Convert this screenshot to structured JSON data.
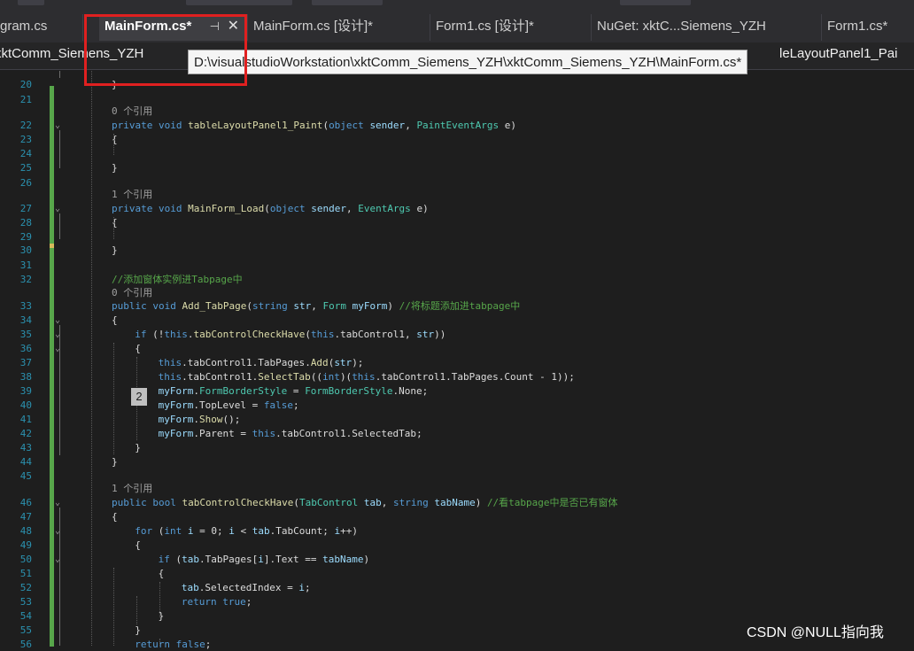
{
  "tabs": [
    {
      "label": "gram.cs"
    },
    {
      "label": "MainForm.cs*",
      "active": true,
      "pin_glyph": "⊣",
      "close_glyph": "✕"
    },
    {
      "label": "MainForm.cs [设计]*"
    },
    {
      "label": "Form1.cs [设计]*"
    },
    {
      "label": "NuGet: xktC...Siemens_YZH"
    },
    {
      "label": "Form1.cs*"
    }
  ],
  "navbar": {
    "project": "xktComm_Siemens_YZH",
    "member": "leLayoutPanel1_Pai"
  },
  "tooltip": "D:\\visualstudioWorkstation\\xktComm_Siemens_YZH\\xktComm_Siemens_YZH\\MainForm.cs*",
  "code_lines": [
    {
      "ln": "20",
      "text": "}"
    },
    {
      "ln": "21",
      "text": ""
    },
    {
      "ref": "0 个引用"
    },
    {
      "ln": "22",
      "text": "private void tableLayoutPanel1_Paint(object sender, PaintEventArgs e)"
    },
    {
      "ln": "23",
      "text": "{"
    },
    {
      "ln": "24",
      "text": ""
    },
    {
      "ln": "25",
      "text": "}"
    },
    {
      "ln": "26",
      "text": ""
    },
    {
      "ref": "1 个引用"
    },
    {
      "ln": "27",
      "text": "private void MainForm_Load(object sender, EventArgs e)"
    },
    {
      "ln": "28",
      "text": "{"
    },
    {
      "ln": "29",
      "text": ""
    },
    {
      "ln": "30",
      "text": "}"
    },
    {
      "ln": "31",
      "text": ""
    },
    {
      "ln": "32",
      "text": "//添加窗体实例进Tabpage中"
    },
    {
      "ref": "0 个引用"
    },
    {
      "ln": "33",
      "text": "public void Add_TabPage(string str, Form myForm) //将标题添加进tabpage中"
    },
    {
      "ln": "34",
      "text": "{"
    },
    {
      "ln": "35",
      "text": "if (!this.tabControlCheckHave(this.tabControl1, str))"
    },
    {
      "ln": "36",
      "text": "{"
    },
    {
      "ln": "37",
      "text": "this.tabControl1.TabPages.Add(str);"
    },
    {
      "ln": "38",
      "text": "this.tabControl1.SelectTab((int)(this.tabControl1.TabPages.Count - 1));"
    },
    {
      "ln": "39",
      "text": "myForm.FormBorderStyle = FormBorderStyle.None;"
    },
    {
      "ln": "40",
      "text": "myForm.TopLevel = false;"
    },
    {
      "ln": "41",
      "text": "myForm.Show();"
    },
    {
      "ln": "42",
      "text": "myForm.Parent = this.tabControl1.SelectedTab;"
    },
    {
      "ln": "43",
      "text": "}"
    },
    {
      "ln": "44",
      "text": "}"
    },
    {
      "ln": "45",
      "text": ""
    },
    {
      "ref": "1 个引用"
    },
    {
      "ln": "46",
      "text": "public bool tabControlCheckHave(TabControl tab, string tabName) //看tabpage中是否已有窗体"
    },
    {
      "ln": "47",
      "text": "{"
    },
    {
      "ln": "48",
      "text": "for (int i = 0; i < tab.TabCount; i++)"
    },
    {
      "ln": "49",
      "text": "{"
    },
    {
      "ln": "50",
      "text": "if (tab.TabPages[i].Text == tabName)"
    },
    {
      "ln": "51",
      "text": "{"
    },
    {
      "ln": "52",
      "text": "tab.SelectedIndex = i;"
    },
    {
      "ln": "53",
      "text": "return true;"
    },
    {
      "ln": "54",
      "text": "}"
    },
    {
      "ln": "55",
      "text": "}"
    },
    {
      "ln": "56",
      "text": "return false;"
    }
  ],
  "badge": "2",
  "watermark": "CSDN @NULL指向我",
  "colors": {
    "keyword": "#569cd6",
    "type": "#4ec9b0",
    "comment": "#57a64a",
    "line_number": "#2b91af",
    "highlight_box": "#e02020"
  }
}
